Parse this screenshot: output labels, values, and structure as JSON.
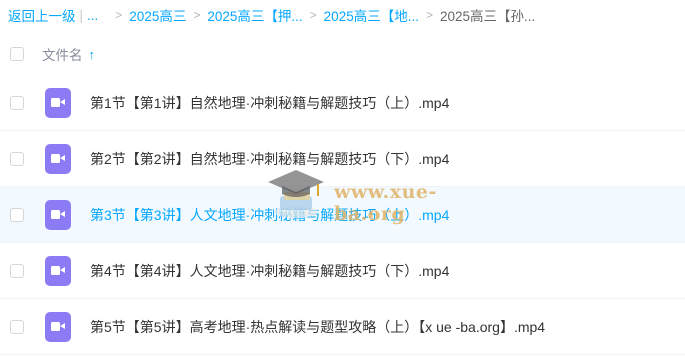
{
  "breadcrumb": {
    "back_label": "返回上一级",
    "pipe": "|",
    "ellipsis": "...",
    "separator": ">",
    "items": [
      "2025高三",
      "2025高三【押...",
      "2025高三【地..."
    ],
    "current": "2025高三【孙..."
  },
  "list_header": {
    "name_label": "文件名",
    "sort_icon": "arrow-up-icon",
    "sort_glyph": "↑"
  },
  "files": [
    {
      "name": "第1节【第1讲】自然地理·冲刺秘籍与解题技巧（上）.mp4",
      "icon": "video-file-icon"
    },
    {
      "name": "第2节【第2讲】自然地理·冲刺秘籍与解题技巧（下）.mp4",
      "icon": "video-file-icon"
    },
    {
      "name": "第3节【第3讲】人文地理·冲刺秘籍与解题技巧（上）.mp4",
      "icon": "video-file-icon",
      "highlighted": true
    },
    {
      "name": "第4节【第4讲】人文地理·冲刺秘籍与解题技巧（下）.mp4",
      "icon": "video-file-icon"
    },
    {
      "name": "第5节【第5讲】高考地理·热点解读与题型攻略（上）【x ue -ba.org】.mp4",
      "icon": "video-file-icon"
    }
  ],
  "watermark": {
    "text": "www.xue-ba.org"
  },
  "colors": {
    "accent": "#06a7ff",
    "video_icon": "#8b7cf5",
    "row_highlight": "#f2faff"
  }
}
